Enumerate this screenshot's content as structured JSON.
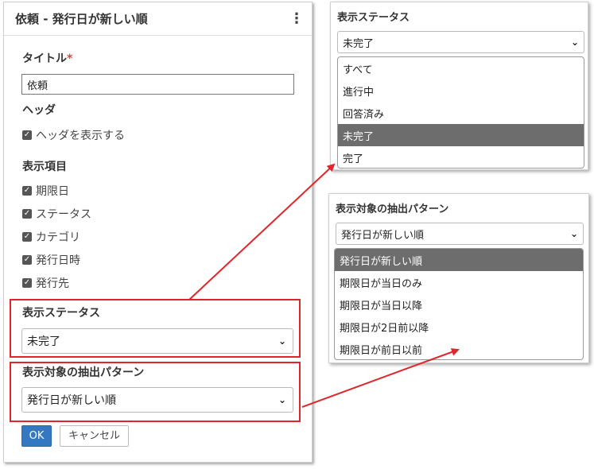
{
  "panel": {
    "title": "依頼 - 発行日が新しい順",
    "title_label": "タイトル",
    "required_mark": "*",
    "title_value": "依頼",
    "header_label": "ヘッダ",
    "header_checkbox": "ヘッダを表示する",
    "display_items_label": "表示項目",
    "display_items": [
      "期限日",
      "ステータス",
      "カテゴリ",
      "発行日時",
      "発行先"
    ],
    "status_label": "表示ステータス",
    "status_value": "未完了",
    "pattern_label": "表示対象の抽出パターン",
    "pattern_value": "発行日が新しい順",
    "ok_label": "OK",
    "cancel_label": "キャンセル"
  },
  "status_popup": {
    "label": "表示ステータス",
    "selected": "未完了",
    "options": [
      "すべて",
      "進行中",
      "回答済み",
      "未完了",
      "完了"
    ],
    "selected_index": 3
  },
  "pattern_popup": {
    "label": "表示対象の抽出パターン",
    "selected": "発行日が新しい順",
    "options": [
      "発行日が新しい順",
      "期限日が当日のみ",
      "期限日が当日以降",
      "期限日が2日前以降",
      "期限日が前日以前"
    ],
    "selected_index": 0
  },
  "colors": {
    "highlight": "#e0262b",
    "primary": "#3378c0",
    "selected_option": "#6d6d6d"
  }
}
